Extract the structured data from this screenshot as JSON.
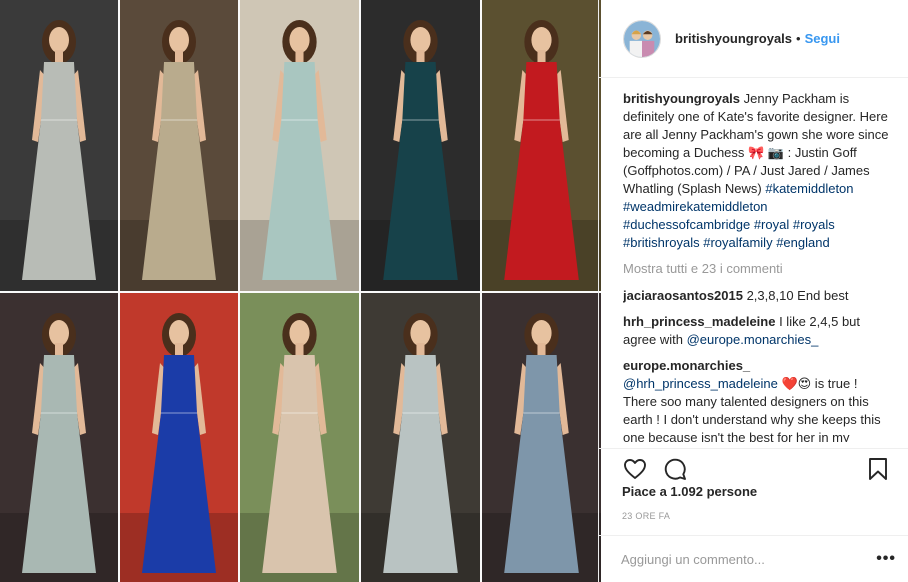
{
  "post": {
    "username": "britishyoungroyals",
    "dot": "•",
    "follow_label": "Segui",
    "photos": [
      {
        "name": "gown-photo-1",
        "bg": "#3a3a3a",
        "dress": "#b8bcb6"
      },
      {
        "name": "gown-photo-2",
        "bg": "#5a4a3a",
        "dress": "#b9ab8d"
      },
      {
        "name": "gown-photo-3",
        "bg": "#cfc6b5",
        "dress": "#a9c6c0"
      },
      {
        "name": "gown-photo-4",
        "bg": "#2c2c2c",
        "dress": "#17424a"
      },
      {
        "name": "gown-photo-5",
        "bg": "#5b5030",
        "dress": "#c21a1f"
      },
      {
        "name": "gown-photo-6",
        "bg": "#3b3030",
        "dress": "#a9b8b3"
      },
      {
        "name": "gown-photo-7",
        "bg": "#c0392b",
        "dress": "#1b3ca8"
      },
      {
        "name": "gown-photo-8",
        "bg": "#7a8f5a",
        "dress": "#d9c4ad"
      },
      {
        "name": "gown-photo-9",
        "bg": "#3e3a34",
        "dress": "#b9c3c2"
      },
      {
        "name": "gown-photo-10",
        "bg": "#3a3030",
        "dress": "#7e96aa"
      }
    ]
  },
  "caption": {
    "user": "britishyoungroyals",
    "text": " Jenny Packham is definitely one of Kate's favorite designer. Here are all Jenny Packham's gown she wore since becoming a Duchess 🎀 📷 : Justin Goff (Goffphotos.com) / PA / Just Jared / James Whatling (Splash News)",
    "hashtags": [
      "#katemiddleton",
      "#weadmirekatemiddleton",
      "#duchessofcambridge",
      "#royal",
      "#royals",
      "#britishroyals",
      "#royalfamily",
      "#england"
    ]
  },
  "show_all_comments": "Mostra tutti e 23 i commenti",
  "comments": [
    {
      "user": "jaciaraosantos2015",
      "pre": " 2,3,8,10 End best",
      "mention": "",
      "post": ""
    },
    {
      "user": "hrh_princess_madeleine",
      "pre": " I like 2,4,5 but agree with ",
      "mention": "@europe.monarchies_",
      "post": ""
    },
    {
      "user": "europe.monarchies_",
      "pre": " ",
      "mention": "@hrh_princess_madeleine",
      "post": " ❤️😍 is true ! There soo many talented designers on this earth ! I don't understand why she keeps this one because isn't the best for her in my opinion"
    }
  ],
  "icons": {
    "like": "heart-icon",
    "comment": "comment-bubble-icon",
    "save": "bookmark-icon",
    "more": "more-options-icon"
  },
  "likes_text": "Piace a 1.092 persone",
  "timestamp": "23 ORE FA",
  "add_comment_placeholder": "Aggiungi un commento...",
  "more_label": "•••",
  "colors": {
    "link_blue": "#3897f0",
    "hashtag_blue": "#003569",
    "muted_gray": "#999999",
    "text": "#262626"
  }
}
